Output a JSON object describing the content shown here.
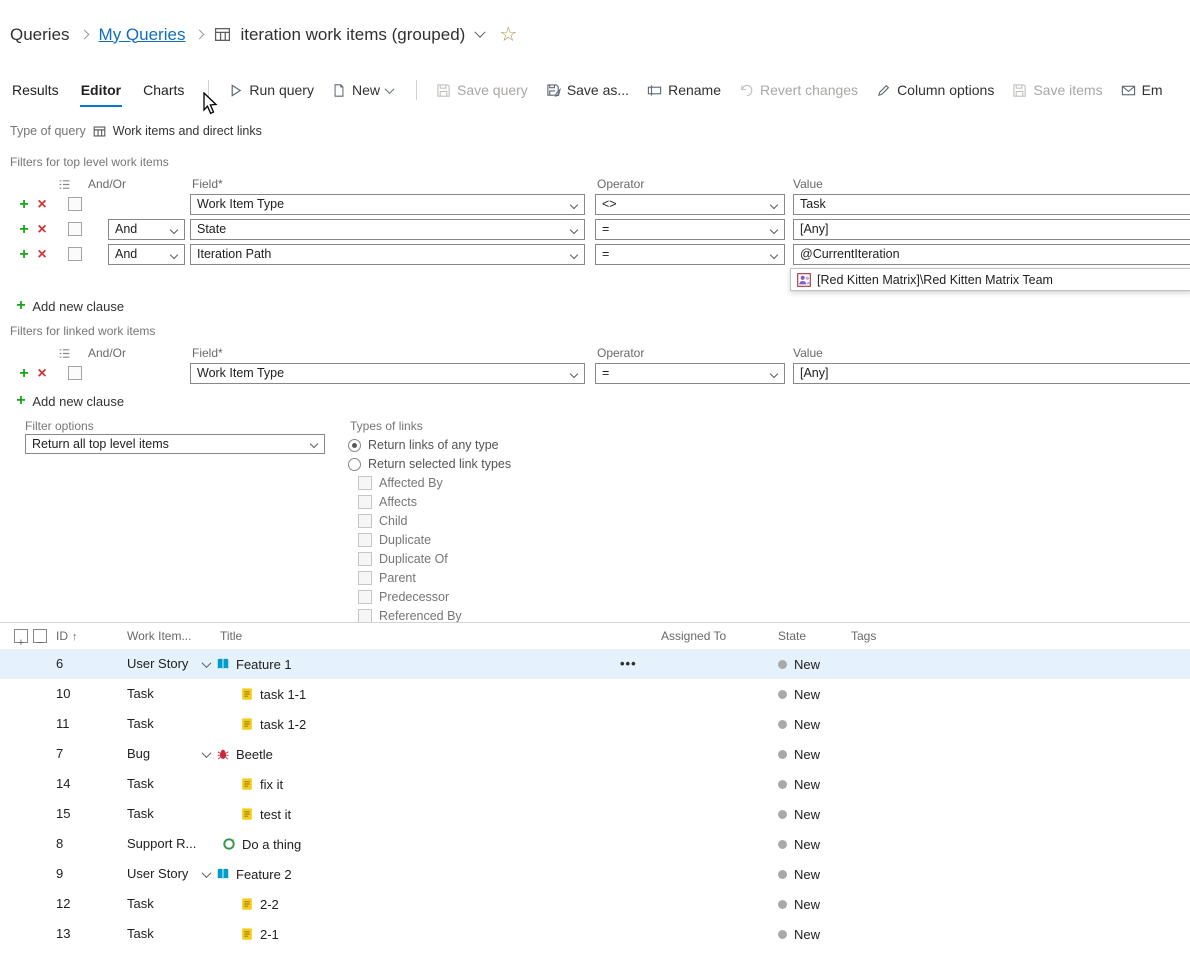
{
  "breadcrumb": {
    "root": "Queries",
    "folder": "My Queries",
    "query_title": "iteration work items (grouped)"
  },
  "tabs": {
    "results": "Results",
    "editor": "Editor",
    "charts": "Charts"
  },
  "toolbar": {
    "run_query": "Run query",
    "new": "New",
    "save_query": "Save query",
    "save_as": "Save as...",
    "rename": "Rename",
    "revert_changes": "Revert changes",
    "column_options": "Column options",
    "save_items": "Save items",
    "email": "Em"
  },
  "query_type": {
    "label": "Type of query",
    "value": "Work items and direct links"
  },
  "top_filters": {
    "title": "Filters for top level work items",
    "headers": {
      "and_or": "And/Or",
      "field": "Field*",
      "operator": "Operator",
      "value": "Value"
    },
    "rows": [
      {
        "and_or": "",
        "field": "Work Item Type",
        "operator": "<>",
        "value": "Task"
      },
      {
        "and_or": "And",
        "field": "State",
        "operator": "=",
        "value": "[Any]"
      },
      {
        "and_or": "And",
        "field": "Iteration Path",
        "operator": "=",
        "value": "@CurrentIteration"
      }
    ],
    "value_suggestion": "[Red Kitten Matrix]\\Red Kitten Matrix Team",
    "add_clause": "Add new clause"
  },
  "linked_filters": {
    "title": "Filters for linked work items",
    "headers": {
      "and_or": "And/Or",
      "field": "Field*",
      "operator": "Operator",
      "value": "Value"
    },
    "rows": [
      {
        "and_or": "",
        "field": "Work Item Type",
        "operator": "=",
        "value": "[Any]"
      }
    ],
    "add_clause": "Add new clause"
  },
  "filter_options": {
    "label": "Filter options",
    "value": "Return all top level items"
  },
  "link_types": {
    "label": "Types of links",
    "radio_any": "Return links of any type",
    "radio_selected": "Return selected link types",
    "options": [
      "Affected By",
      "Affects",
      "Child",
      "Duplicate",
      "Duplicate Of",
      "Parent",
      "Predecessor",
      "Referenced By"
    ]
  },
  "results": {
    "columns": {
      "id": "ID",
      "work_item_type": "Work Item...",
      "title": "Title",
      "assigned_to": "Assigned To",
      "state": "State",
      "tags": "Tags"
    },
    "rows": [
      {
        "id": "6",
        "type": "User Story",
        "title": "Feature 1",
        "state": "New",
        "menu": "•••"
      },
      {
        "id": "10",
        "type": "Task",
        "title": "task 1-1",
        "state": "New"
      },
      {
        "id": "11",
        "type": "Task",
        "title": "task 1-2",
        "state": "New"
      },
      {
        "id": "7",
        "type": "Bug",
        "title": "Beetle",
        "state": "New"
      },
      {
        "id": "14",
        "type": "Task",
        "title": "fix it",
        "state": "New"
      },
      {
        "id": "15",
        "type": "Task",
        "title": "test it",
        "state": "New"
      },
      {
        "id": "8",
        "type": "Support R...",
        "title": "Do a thing",
        "state": "New"
      },
      {
        "id": "9",
        "type": "User Story",
        "title": "Feature 2",
        "state": "New"
      },
      {
        "id": "12",
        "type": "Task",
        "title": "2-2",
        "state": "New"
      },
      {
        "id": "13",
        "type": "Task",
        "title": "2-1",
        "state": "New"
      }
    ]
  },
  "colors": {
    "accent": "#0078d4",
    "link": "#106ebe",
    "user_story_icon": "#009ccc",
    "task_icon": "#f2cb1d",
    "bug_icon": "#cc293d",
    "support_request_icon": "#339947",
    "state_new_dot": "#a9a9a9",
    "selected_row_bg": "#e5f1fb"
  }
}
